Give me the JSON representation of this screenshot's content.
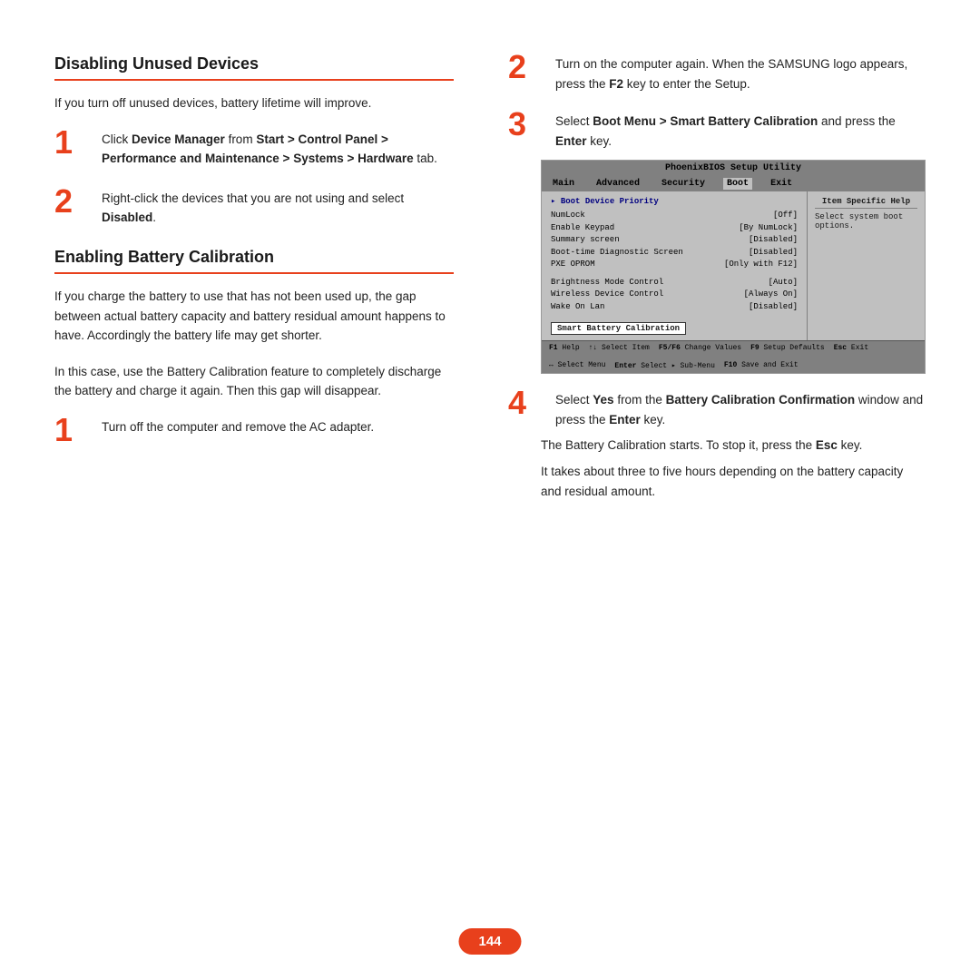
{
  "page": {
    "number": "144",
    "left": {
      "section1": {
        "title": "Disabling Unused Devices",
        "intro": "If you turn off unused devices, battery lifetime will improve.",
        "steps": [
          {
            "number": "1",
            "html": "Click <b>Device Manager</b> from <b>Start &gt; Control Panel &gt; Performance and Maintenance &gt; Systems &gt; Hardware</b> tab."
          },
          {
            "number": "2",
            "html": "Right-click the devices that you are not using and select <b>Disabled</b>."
          }
        ]
      },
      "section2": {
        "title": "Enabling Battery Calibration",
        "intro1": "If you charge the battery to use that has not been used up, the gap between actual battery capacity and battery residual amount happens to have. Accordingly the battery life may get shorter.",
        "intro2": "In this case, use the Battery Calibration feature to completely discharge the battery and charge it again. Then this gap will disappear.",
        "step1": {
          "number": "1",
          "text": "Turn off the computer and remove the AC adapter."
        }
      }
    },
    "right": {
      "step2": {
        "number": "2",
        "html": "Turn on the computer again. When the SAMSUNG logo appears, press the <b>F2</b> key to enter the Setup."
      },
      "step3": {
        "number": "3",
        "html": "Select <b>Boot Menu &gt; Smart Battery Calibration</b> and press the <b>Enter</b> key."
      },
      "step4": {
        "number": "4",
        "html": "Select <b>Yes</b> from the <b>Battery Calibration Confirmation</b> window and press the <b>Enter</b> key."
      },
      "step4_extra1": "The Battery Calibration starts. To stop it, press the",
      "step4_esc": "Esc",
      "step4_extra2": " key.",
      "step4_extra3": "It takes about three to five hours depending on the battery capacity and residual amount.",
      "bios": {
        "title": "PhoenixBIOS Setup Utility",
        "menu": [
          "Main",
          "Advanced",
          "Security",
          "Boot",
          "Exit"
        ],
        "active_menu": "Boot",
        "section_header": "Boot Device Priority",
        "rows_group1": [
          {
            "label": "NumLock",
            "value": "[Off]"
          },
          {
            "label": "Enable Keypad",
            "value": "[By NumLock]"
          },
          {
            "label": "Summary screen",
            "value": "[Disabled]"
          },
          {
            "label": "Boot-time Diagnostic Screen",
            "value": "[Disabled]"
          },
          {
            "label": "PXE OPROM",
            "value": "[Only with F12]"
          }
        ],
        "rows_group2": [
          {
            "label": "Brightness Mode Control",
            "value": "[Auto]"
          },
          {
            "label": "Wireless Device Control",
            "value": "[Always On]"
          },
          {
            "label": "Wake On Lan",
            "value": "[Disabled]"
          }
        ],
        "calibration_button": "Smart Battery Calibration",
        "help_title": "Item Specific Help",
        "help_text": "Select system boot options.",
        "footer": [
          {
            "key": "F1",
            "label": "Help"
          },
          {
            "key": "↑↓",
            "label": "Select Item"
          },
          {
            "key": "F5/F6",
            "label": "Change Values"
          },
          {
            "key": "F9",
            "label": "Setup Defaults"
          },
          {
            "key": "Esc",
            "label": "Exit"
          },
          {
            "key": "↔",
            "label": "Select Menu"
          },
          {
            "key": "Enter",
            "label": "Select ▸ Sub-Menu"
          },
          {
            "key": "F10",
            "label": "Save and Exit"
          }
        ]
      }
    }
  }
}
